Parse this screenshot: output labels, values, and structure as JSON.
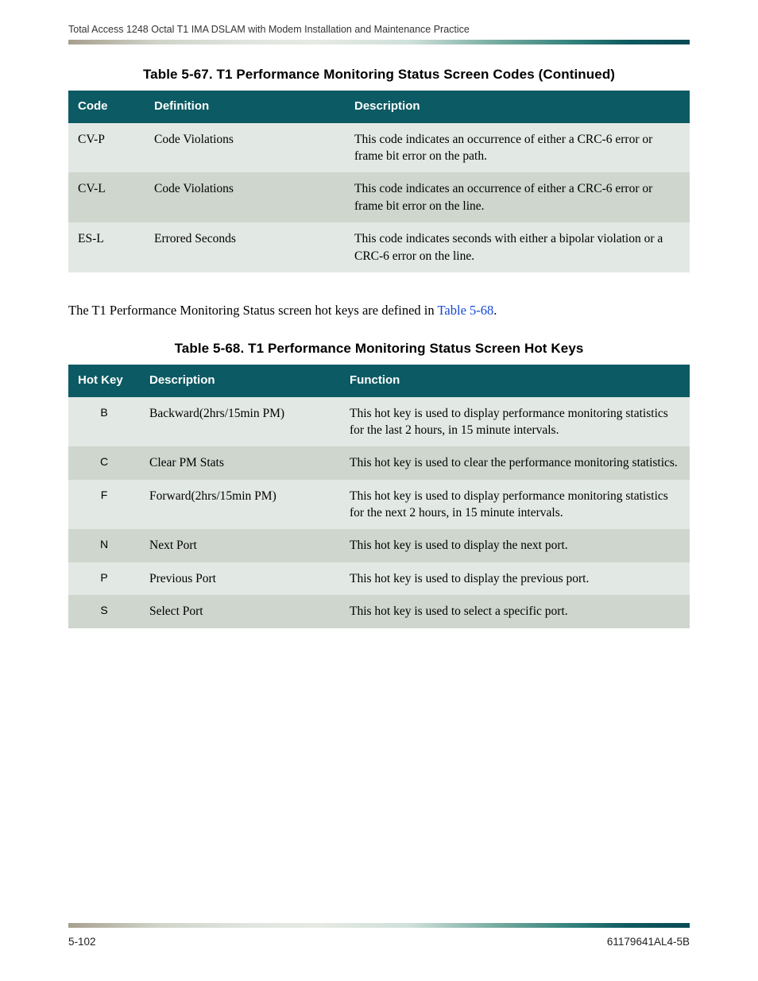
{
  "header": {
    "running_title": "Total Access 1248 Octal T1 IMA DSLAM with Modem Installation and Maintenance Practice"
  },
  "table67": {
    "caption": "Table 5-67.  T1 Performance Monitoring Status Screen Codes (Continued)",
    "headers": {
      "col1": "Code",
      "col2": "Definition",
      "col3": "Description"
    },
    "rows": [
      {
        "code": "CV-P",
        "definition": "Code Violations",
        "description": "This code indicates an occurrence of either a CRC-6 error or frame bit error on the path."
      },
      {
        "code": "CV-L",
        "definition": "Code Violations",
        "description": "This code indicates an occurrence of either a CRC-6 error or frame bit error on the line."
      },
      {
        "code": "ES-L",
        "definition": "Errored Seconds",
        "description": "This code indicates seconds with either a bipolar violation or a CRC-6 error on the line."
      }
    ]
  },
  "paragraph": {
    "pre": "The T1 Performance Monitoring Status screen hot keys are defined in ",
    "link": "Table 5-68",
    "post": "."
  },
  "table68": {
    "caption": "Table 5-68.  T1 Performance Monitoring Status Screen Hot Keys",
    "headers": {
      "col1": "Hot Key",
      "col2": "Description",
      "col3": "Function"
    },
    "rows": [
      {
        "hotkey": "B",
        "description": "Backward(2hrs/15min PM)",
        "function": "This hot key is used to display performance monitoring statistics for the last 2 hours, in 15 minute intervals."
      },
      {
        "hotkey": "C",
        "description": "Clear PM Stats",
        "function": "This hot key is used to clear the performance monitoring statistics."
      },
      {
        "hotkey": "F",
        "description": "Forward(2hrs/15min PM)",
        "function": "This hot key is used to display performance monitoring statistics for the next 2 hours, in 15 minute intervals."
      },
      {
        "hotkey": "N",
        "description": "Next Port",
        "function": "This hot key is used to display the next port."
      },
      {
        "hotkey": "P",
        "description": "Previous Port",
        "function": "This hot key is used to display the previous port."
      },
      {
        "hotkey": "S",
        "description": "Select Port",
        "function": "This hot key is used to select a specific port."
      }
    ]
  },
  "footer": {
    "page_number": "5-102",
    "doc_number": "61179641AL4-5B"
  }
}
